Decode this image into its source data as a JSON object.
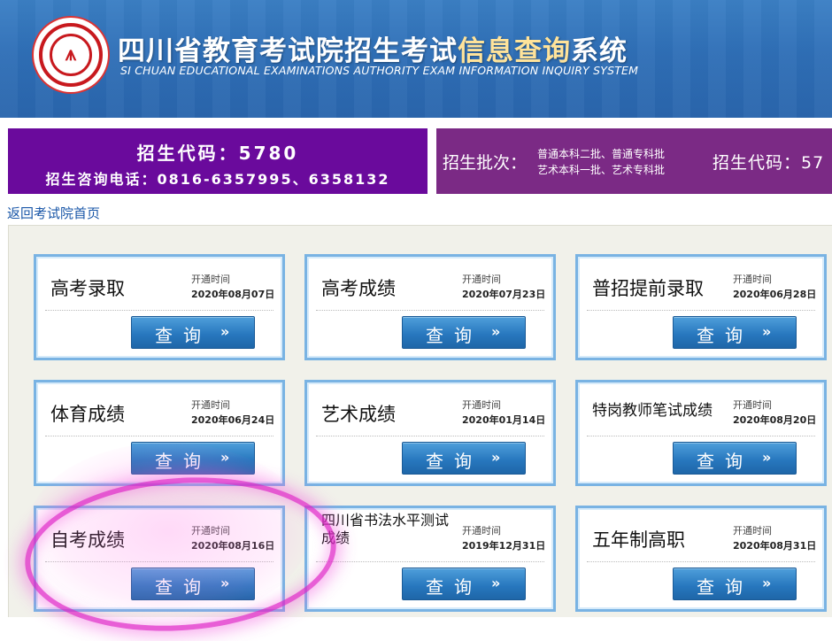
{
  "header": {
    "logo_icon": "authority-seal-logo",
    "title_part1": "四川省教育考试院招生考试",
    "title_highlight": "信息查询",
    "title_part2": "系统",
    "subtitle": "SI CHUAN EDUCATIONAL EXAMINATIONS AUTHORITY EXAM INFORMATION INQUIRY SYSTEM"
  },
  "banner": {
    "admission_code": "招生代码：5780",
    "consult_phone": "招生咨询电话：0816-6357995、6358132",
    "batch_label": "招生批次：",
    "batch_line1": "普通本科二批、普通专科批",
    "batch_line2": "艺术本科一批、艺术专科批",
    "admission_code_repeat": "招生代码：57"
  },
  "back_link": "返回考试院首页",
  "open_time_label": "开通时间",
  "query_button_label": "查询",
  "query_button_arrow": "»",
  "cards": [
    {
      "name": "高考录取",
      "date": "2020年08月07日"
    },
    {
      "name": "高考成绩",
      "date": "2020年07月23日"
    },
    {
      "name": "普招提前录取",
      "date": "2020年06月28日"
    },
    {
      "name": "体育成绩",
      "date": "2020年06月24日"
    },
    {
      "name": "艺术成绩",
      "date": "2020年01月14日"
    },
    {
      "name": "特岗教师笔试成绩",
      "date": "2020年08月20日"
    },
    {
      "name": "自考成绩",
      "date": "2020年08月16日"
    },
    {
      "name": "四川省书法水平测试成绩",
      "date": "2019年12月31日"
    },
    {
      "name": "五年制高职",
      "date": "2020年08月31日"
    }
  ],
  "colors": {
    "header_blue": "#2f6fb7",
    "banner_left_purple": "#6a0a9c",
    "banner_right_purple": "#7b2a85",
    "button_blue": "#2878bf",
    "highlight_pink": "#e028c8"
  }
}
